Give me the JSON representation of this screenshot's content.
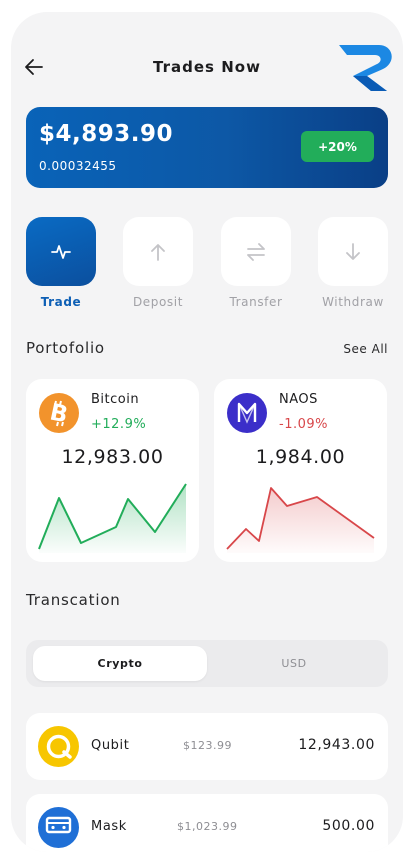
{
  "header": {
    "title": "Trades Now",
    "back_icon": "arrow-left-icon",
    "logo_icon": "brand-logo-icon"
  },
  "balance": {
    "amount": "$4,893.90",
    "sub": "0.00032455",
    "badge": "+20%"
  },
  "actions": [
    {
      "label": "Trade",
      "icon": "pulse-icon",
      "active": true
    },
    {
      "label": "Deposit",
      "icon": "arrow-up-icon",
      "active": false
    },
    {
      "label": "Transfer",
      "icon": "swap-icon",
      "active": false
    },
    {
      "label": "Withdraw",
      "icon": "arrow-down-icon",
      "active": false
    }
  ],
  "portfolio": {
    "title": "Portofolio",
    "see_all": "See All",
    "cards": [
      {
        "name": "Bitcoin",
        "change": "+12.9%",
        "value": "12,983.00",
        "trend": "up",
        "color": "#22ad5a",
        "icon": "bitcoin-icon"
      },
      {
        "name": "NAOS",
        "change": "-1.09%",
        "value": "1,984.00",
        "trend": "down",
        "color": "#d8474a",
        "icon": "naos-icon"
      }
    ]
  },
  "transactions": {
    "title": "Transcation",
    "tabs": [
      "Crypto",
      "USD"
    ],
    "active_tab": "Crypto",
    "items": [
      {
        "name": "Qubit",
        "price": "$123.99",
        "amount": "12,943.00",
        "icon": "qubit-icon"
      },
      {
        "name": "Mask",
        "price": "$1,023.99",
        "amount": "500.00",
        "icon": "mask-icon"
      }
    ]
  },
  "colors": {
    "primary": "#0d5fb5",
    "positive": "#22ad5a",
    "negative": "#d8474a",
    "background": "#f4f4f5"
  }
}
